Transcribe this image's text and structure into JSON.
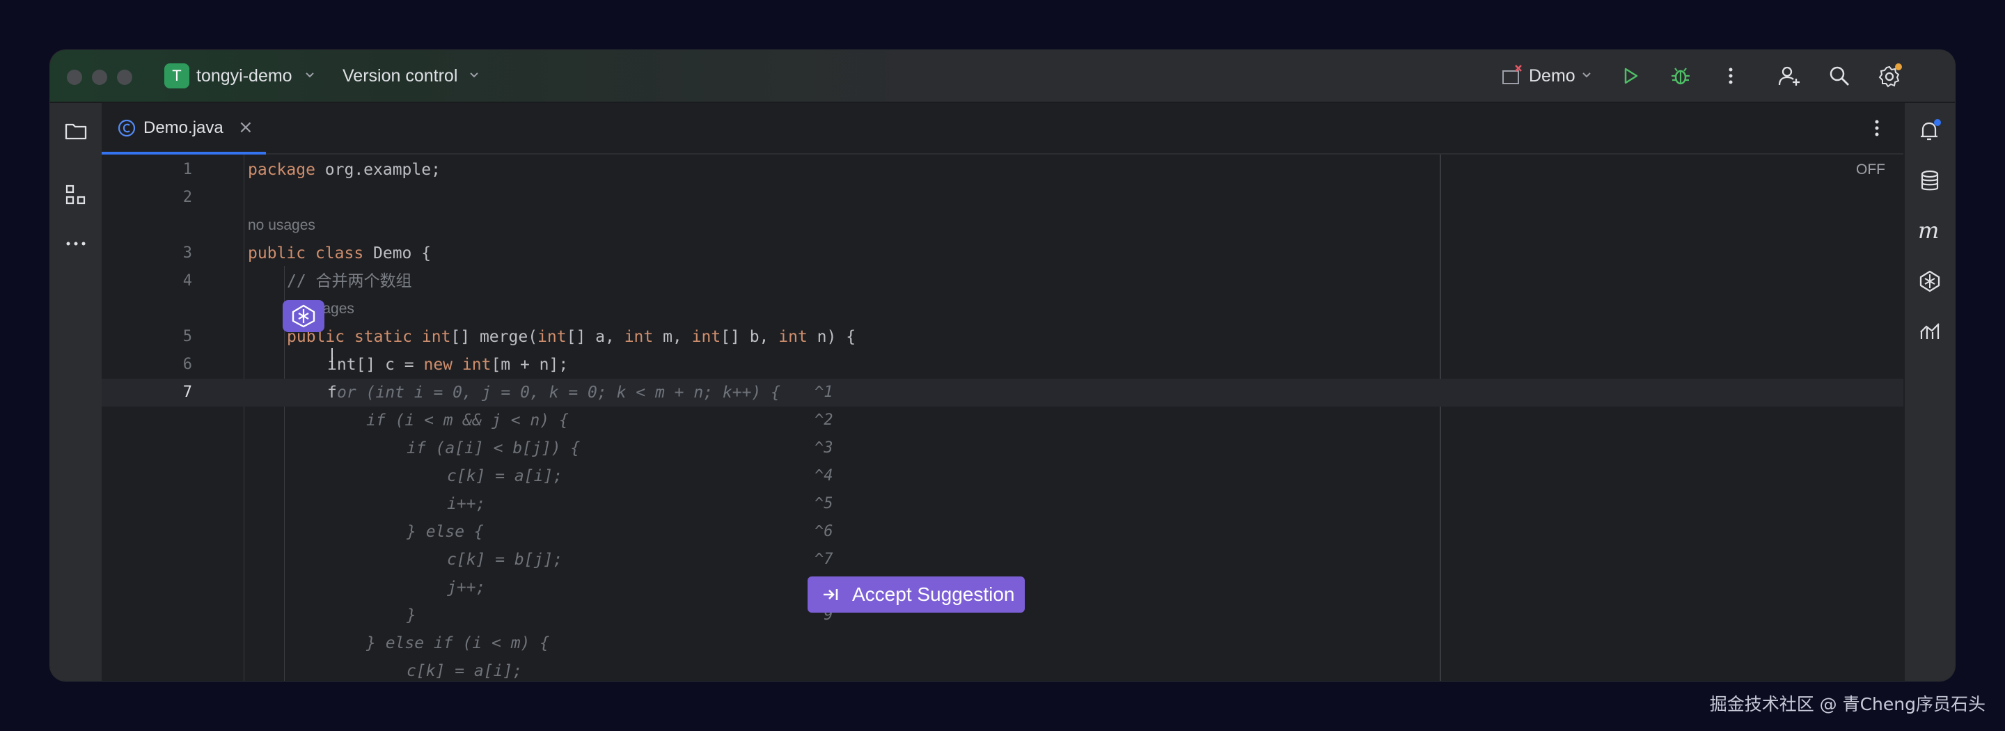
{
  "titlebar": {
    "project_initial": "T",
    "project_name": "tongyi-demo",
    "vcs_label": "Version control",
    "run_config": "Demo"
  },
  "tabs": [
    {
      "label": "Demo.java",
      "close": "×"
    }
  ],
  "editor": {
    "off_label": "OFF",
    "usage_hint": "no usages",
    "lines": {
      "l1": {
        "num": "1",
        "kw": "package",
        "rest": " org.example;"
      },
      "l2": {
        "num": "2"
      },
      "l3": {
        "num": "3",
        "kw": "public class",
        "rest": " Demo {"
      },
      "l4": {
        "num": "4",
        "comment": "// 合并两个数组"
      },
      "l5": {
        "num": "5",
        "kw1": "public static",
        "kw2": "int",
        "t1": "[] merge(",
        "kw3": "int",
        "t2": "[] a, ",
        "kw4": "int",
        "t3": " m, ",
        "kw5": "int",
        "t4": "[] b, ",
        "kw6": "int",
        "t5": " n) {"
      },
      "l6": {
        "num": "6",
        "t1": "int[] c = ",
        "kw": "new",
        "kw2": "int",
        "t2": "[m + n];"
      },
      "l7": {
        "num": "7",
        "typed": "f"
      }
    },
    "suggestion": [
      {
        "text": "or (int i = 0, j = 0, k = 0; k < m + n; k++) {",
        "shortcut": "^1"
      },
      {
        "text": "if (i < m && j < n) {",
        "shortcut": "^2"
      },
      {
        "text": "if (a[i] < b[j]) {",
        "shortcut": "^3"
      },
      {
        "text": "c[k] = a[i];",
        "shortcut": "^4"
      },
      {
        "text": "i++;",
        "shortcut": "^5"
      },
      {
        "text": "} else {",
        "shortcut": "^6"
      },
      {
        "text": "c[k] = b[j];",
        "shortcut": "^7"
      },
      {
        "text": "j++;",
        "shortcut": "^8"
      },
      {
        "text": "}",
        "shortcut": "^9"
      },
      {
        "text": "} else if (i < m) {",
        "shortcut": ""
      },
      {
        "text": "c[k] = a[i];",
        "shortcut": ""
      }
    ],
    "accept_button": "Accept Suggestion"
  },
  "watermark": "掘金技术社区 @ 青Cheng序员石头",
  "colors": {
    "keyword": "#cf8e6d",
    "accent": "#3574f0",
    "ai_purple": "#7c5fd6",
    "run_green": "#4fbf67"
  }
}
